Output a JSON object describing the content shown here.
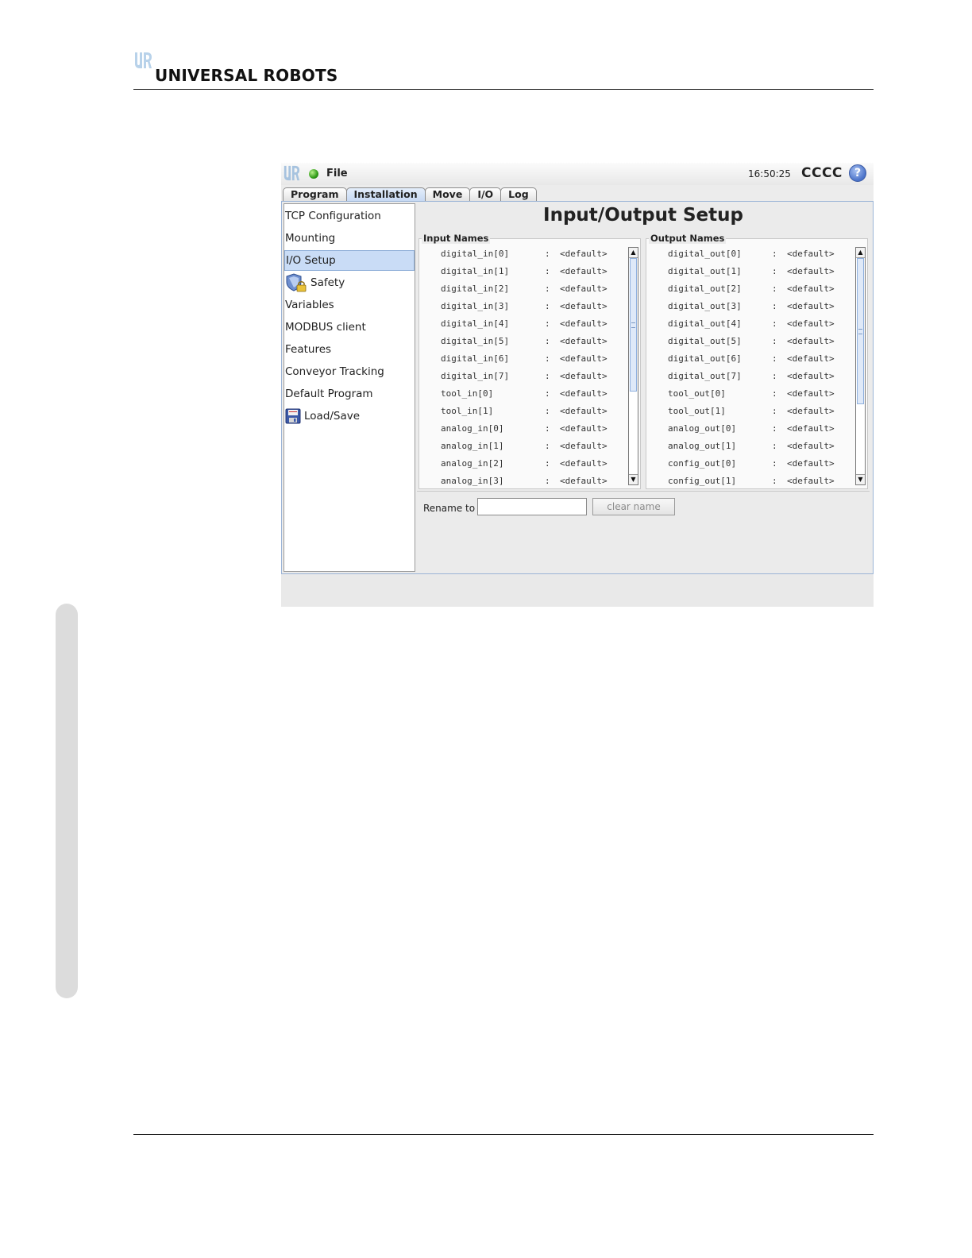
{
  "brand": {
    "name": "UNIVERSAL ROBOTS"
  },
  "app": {
    "menu": {
      "file": "File"
    },
    "clock": "16:50:25",
    "robot_name": "CCCC",
    "help": "?",
    "tabs": [
      {
        "label": "Program"
      },
      {
        "label": "Installation"
      },
      {
        "label": "Move"
      },
      {
        "label": "I/O"
      },
      {
        "label": "Log"
      }
    ],
    "active_tab": "Installation",
    "nav": [
      {
        "label": "TCP Configuration"
      },
      {
        "label": "Mounting"
      },
      {
        "label": "I/O Setup"
      },
      {
        "label": "Safety"
      },
      {
        "label": "Variables"
      },
      {
        "label": "MODBUS client"
      },
      {
        "label": "Features"
      },
      {
        "label": "Conveyor Tracking"
      },
      {
        "label": "Default Program"
      },
      {
        "label": "Load/Save"
      }
    ],
    "selected_nav": "I/O Setup",
    "page_title": "Input/Output Setup",
    "input_group": {
      "title": "Input Names",
      "rows": [
        {
          "name": "digital_in[0]",
          "sep": ":",
          "value": "<default>"
        },
        {
          "name": "digital_in[1]",
          "sep": ":",
          "value": "<default>"
        },
        {
          "name": "digital_in[2]",
          "sep": ":",
          "value": "<default>"
        },
        {
          "name": "digital_in[3]",
          "sep": ":",
          "value": "<default>"
        },
        {
          "name": "digital_in[4]",
          "sep": ":",
          "value": "<default>"
        },
        {
          "name": "digital_in[5]",
          "sep": ":",
          "value": "<default>"
        },
        {
          "name": "digital_in[6]",
          "sep": ":",
          "value": "<default>"
        },
        {
          "name": "digital_in[7]",
          "sep": ":",
          "value": "<default>"
        },
        {
          "name": "tool_in[0]",
          "sep": ":",
          "value": "<default>"
        },
        {
          "name": "tool_in[1]",
          "sep": ":",
          "value": "<default>"
        },
        {
          "name": "analog_in[0]",
          "sep": ":",
          "value": "<default>"
        },
        {
          "name": "analog_in[1]",
          "sep": ":",
          "value": "<default>"
        },
        {
          "name": "analog_in[2]",
          "sep": ":",
          "value": "<default>"
        },
        {
          "name": "analog_in[3]",
          "sep": ":",
          "value": "<default>"
        }
      ]
    },
    "output_group": {
      "title": "Output Names",
      "rows": [
        {
          "name": "digital_out[0]",
          "sep": ":",
          "value": "<default>"
        },
        {
          "name": "digital_out[1]",
          "sep": ":",
          "value": "<default>"
        },
        {
          "name": "digital_out[2]",
          "sep": ":",
          "value": "<default>"
        },
        {
          "name": "digital_out[3]",
          "sep": ":",
          "value": "<default>"
        },
        {
          "name": "digital_out[4]",
          "sep": ":",
          "value": "<default>"
        },
        {
          "name": "digital_out[5]",
          "sep": ":",
          "value": "<default>"
        },
        {
          "name": "digital_out[6]",
          "sep": ":",
          "value": "<default>"
        },
        {
          "name": "digital_out[7]",
          "sep": ":",
          "value": "<default>"
        },
        {
          "name": "tool_out[0]",
          "sep": ":",
          "value": "<default>"
        },
        {
          "name": "tool_out[1]",
          "sep": ":",
          "value": "<default>"
        },
        {
          "name": "analog_out[0]",
          "sep": ":",
          "value": "<default>"
        },
        {
          "name": "analog_out[1]",
          "sep": ":",
          "value": "<default>"
        },
        {
          "name": "config_out[0]",
          "sep": ":",
          "value": "<default>"
        },
        {
          "name": "config_out[1]",
          "sep": ":",
          "value": "<default>"
        }
      ]
    },
    "rename": {
      "label": "Rename to",
      "value": "",
      "button": "clear name"
    },
    "icons": {
      "status": "status-ok-icon",
      "help": "help-icon",
      "safety": "shield-lock-icon",
      "loadsave": "floppy-disk-icon",
      "scroll_up": "arrow-up-icon",
      "scroll_down": "arrow-down-icon"
    }
  }
}
